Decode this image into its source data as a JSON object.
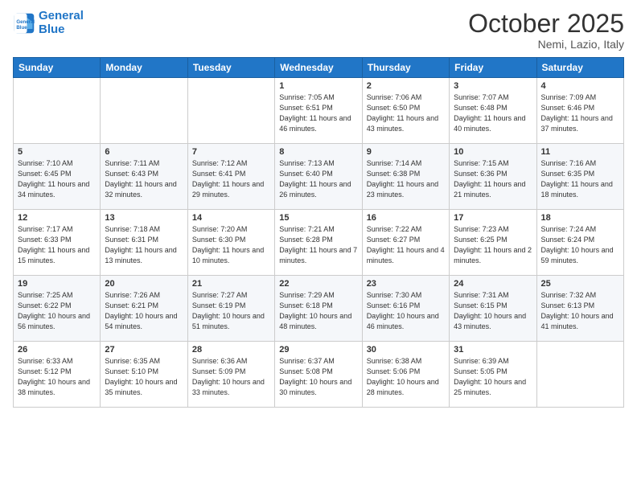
{
  "logo": {
    "line1": "General",
    "line2": "Blue"
  },
  "header": {
    "title": "October 2025",
    "location": "Nemi, Lazio, Italy"
  },
  "days_of_week": [
    "Sunday",
    "Monday",
    "Tuesday",
    "Wednesday",
    "Thursday",
    "Friday",
    "Saturday"
  ],
  "weeks": [
    [
      {
        "num": "",
        "info": ""
      },
      {
        "num": "",
        "info": ""
      },
      {
        "num": "",
        "info": ""
      },
      {
        "num": "1",
        "info": "Sunrise: 7:05 AM\nSunset: 6:51 PM\nDaylight: 11 hours\nand 46 minutes."
      },
      {
        "num": "2",
        "info": "Sunrise: 7:06 AM\nSunset: 6:50 PM\nDaylight: 11 hours\nand 43 minutes."
      },
      {
        "num": "3",
        "info": "Sunrise: 7:07 AM\nSunset: 6:48 PM\nDaylight: 11 hours\nand 40 minutes."
      },
      {
        "num": "4",
        "info": "Sunrise: 7:09 AM\nSunset: 6:46 PM\nDaylight: 11 hours\nand 37 minutes."
      }
    ],
    [
      {
        "num": "5",
        "info": "Sunrise: 7:10 AM\nSunset: 6:45 PM\nDaylight: 11 hours\nand 34 minutes."
      },
      {
        "num": "6",
        "info": "Sunrise: 7:11 AM\nSunset: 6:43 PM\nDaylight: 11 hours\nand 32 minutes."
      },
      {
        "num": "7",
        "info": "Sunrise: 7:12 AM\nSunset: 6:41 PM\nDaylight: 11 hours\nand 29 minutes."
      },
      {
        "num": "8",
        "info": "Sunrise: 7:13 AM\nSunset: 6:40 PM\nDaylight: 11 hours\nand 26 minutes."
      },
      {
        "num": "9",
        "info": "Sunrise: 7:14 AM\nSunset: 6:38 PM\nDaylight: 11 hours\nand 23 minutes."
      },
      {
        "num": "10",
        "info": "Sunrise: 7:15 AM\nSunset: 6:36 PM\nDaylight: 11 hours\nand 21 minutes."
      },
      {
        "num": "11",
        "info": "Sunrise: 7:16 AM\nSunset: 6:35 PM\nDaylight: 11 hours\nand 18 minutes."
      }
    ],
    [
      {
        "num": "12",
        "info": "Sunrise: 7:17 AM\nSunset: 6:33 PM\nDaylight: 11 hours\nand 15 minutes."
      },
      {
        "num": "13",
        "info": "Sunrise: 7:18 AM\nSunset: 6:31 PM\nDaylight: 11 hours\nand 13 minutes."
      },
      {
        "num": "14",
        "info": "Sunrise: 7:20 AM\nSunset: 6:30 PM\nDaylight: 11 hours\nand 10 minutes."
      },
      {
        "num": "15",
        "info": "Sunrise: 7:21 AM\nSunset: 6:28 PM\nDaylight: 11 hours\nand 7 minutes."
      },
      {
        "num": "16",
        "info": "Sunrise: 7:22 AM\nSunset: 6:27 PM\nDaylight: 11 hours\nand 4 minutes."
      },
      {
        "num": "17",
        "info": "Sunrise: 7:23 AM\nSunset: 6:25 PM\nDaylight: 11 hours\nand 2 minutes."
      },
      {
        "num": "18",
        "info": "Sunrise: 7:24 AM\nSunset: 6:24 PM\nDaylight: 10 hours\nand 59 minutes."
      }
    ],
    [
      {
        "num": "19",
        "info": "Sunrise: 7:25 AM\nSunset: 6:22 PM\nDaylight: 10 hours\nand 56 minutes."
      },
      {
        "num": "20",
        "info": "Sunrise: 7:26 AM\nSunset: 6:21 PM\nDaylight: 10 hours\nand 54 minutes."
      },
      {
        "num": "21",
        "info": "Sunrise: 7:27 AM\nSunset: 6:19 PM\nDaylight: 10 hours\nand 51 minutes."
      },
      {
        "num": "22",
        "info": "Sunrise: 7:29 AM\nSunset: 6:18 PM\nDaylight: 10 hours\nand 48 minutes."
      },
      {
        "num": "23",
        "info": "Sunrise: 7:30 AM\nSunset: 6:16 PM\nDaylight: 10 hours\nand 46 minutes."
      },
      {
        "num": "24",
        "info": "Sunrise: 7:31 AM\nSunset: 6:15 PM\nDaylight: 10 hours\nand 43 minutes."
      },
      {
        "num": "25",
        "info": "Sunrise: 7:32 AM\nSunset: 6:13 PM\nDaylight: 10 hours\nand 41 minutes."
      }
    ],
    [
      {
        "num": "26",
        "info": "Sunrise: 6:33 AM\nSunset: 5:12 PM\nDaylight: 10 hours\nand 38 minutes."
      },
      {
        "num": "27",
        "info": "Sunrise: 6:35 AM\nSunset: 5:10 PM\nDaylight: 10 hours\nand 35 minutes."
      },
      {
        "num": "28",
        "info": "Sunrise: 6:36 AM\nSunset: 5:09 PM\nDaylight: 10 hours\nand 33 minutes."
      },
      {
        "num": "29",
        "info": "Sunrise: 6:37 AM\nSunset: 5:08 PM\nDaylight: 10 hours\nand 30 minutes."
      },
      {
        "num": "30",
        "info": "Sunrise: 6:38 AM\nSunset: 5:06 PM\nDaylight: 10 hours\nand 28 minutes."
      },
      {
        "num": "31",
        "info": "Sunrise: 6:39 AM\nSunset: 5:05 PM\nDaylight: 10 hours\nand 25 minutes."
      },
      {
        "num": "",
        "info": ""
      }
    ]
  ]
}
